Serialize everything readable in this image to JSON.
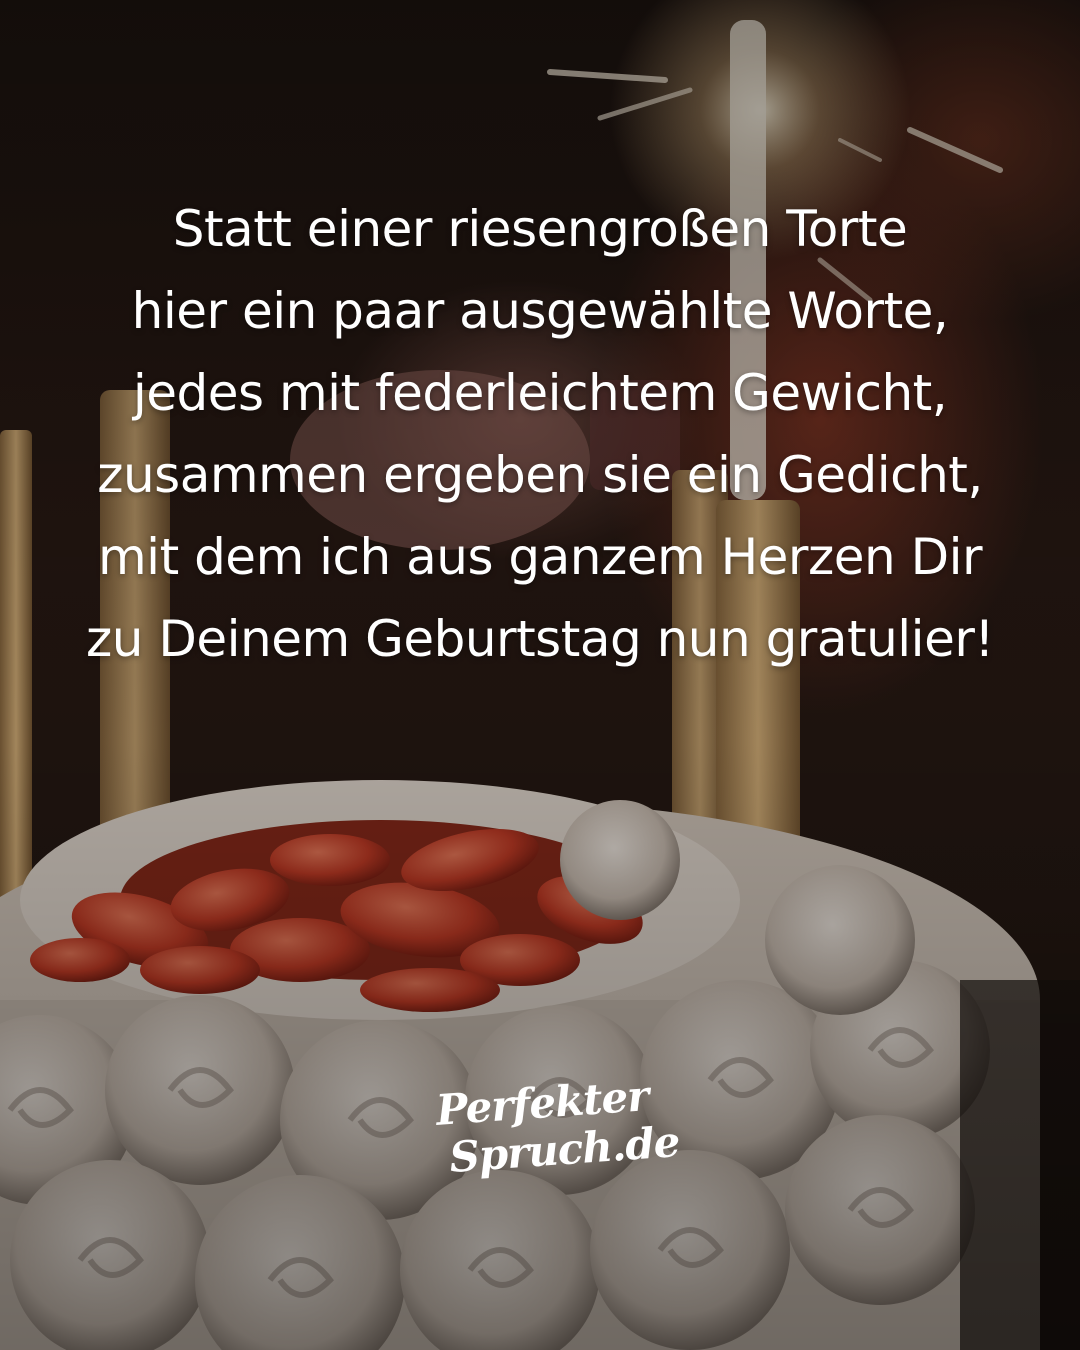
{
  "quote": {
    "lines": [
      "Statt einer riesengroßen Torte",
      "hier ein paar ausgewählte Worte,",
      "jedes mit federleichtem Gewicht,",
      "zusammen ergeben sie ein Gedicht,",
      "mit dem ich aus ganzem Herzen Dir",
      "zu Deinem Geburtstag nun gratulier!"
    ]
  },
  "logo": {
    "line1": "Perfekter",
    "line2": "Spruch.de"
  },
  "colors": {
    "text": "#ffffff",
    "background": "#1d1410",
    "cream": "#e8ddd2",
    "strawberry": "#c8402c",
    "candle": "#c9a46e"
  }
}
